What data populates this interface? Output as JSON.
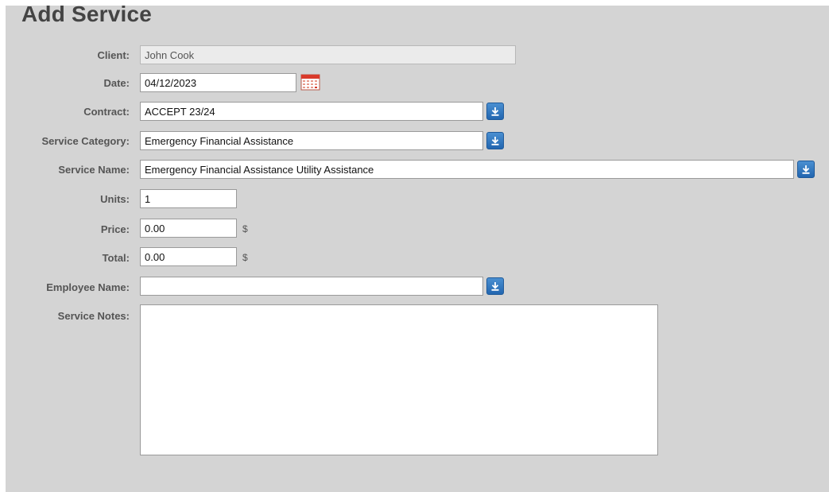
{
  "page": {
    "title": "Add Service"
  },
  "form": {
    "client": {
      "label": "Client:",
      "value": "John Cook"
    },
    "date": {
      "label": "Date:",
      "value": "04/12/2023"
    },
    "contract": {
      "label": "Contract:",
      "value": "ACCEPT 23/24"
    },
    "service_category": {
      "label": "Service Category:",
      "value": "Emergency Financial Assistance"
    },
    "service_name": {
      "label": "Service Name:",
      "value": "Emergency Financial Assistance Utility Assistance"
    },
    "units": {
      "label": "Units:",
      "value": "1"
    },
    "price": {
      "label": "Price:",
      "value": "0.00",
      "unit": "$"
    },
    "total": {
      "label": "Total:",
      "value": "0.00",
      "unit": "$"
    },
    "employee_name": {
      "label": "Employee Name:",
      "value": ""
    },
    "service_notes": {
      "label": "Service Notes:",
      "value": ""
    }
  },
  "icons": {
    "dropdown": "dropdown-arrow-icon",
    "calendar": "calendar-icon"
  },
  "colors": {
    "panel_bg": "#d4d4d4",
    "dropdown_button": "#2a6fb8",
    "calendar_accent": "#d93a2b"
  }
}
